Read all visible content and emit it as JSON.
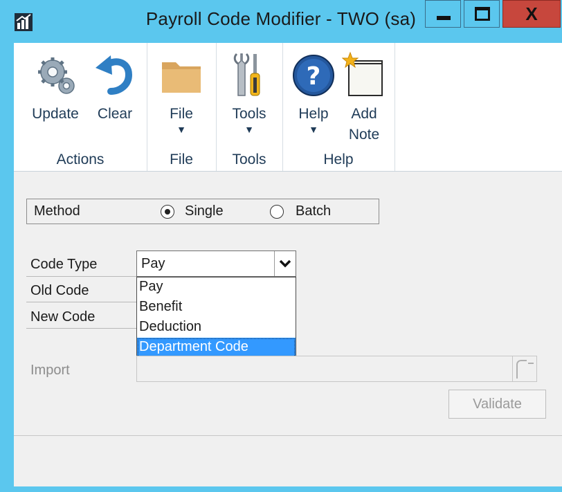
{
  "window": {
    "title": "Payroll Code Modifier  -  TWO (sa)",
    "close_glyph": "X",
    "icons": {
      "app": "chart-icon",
      "minimize": "minimize-icon",
      "maximize": "maximize-icon",
      "close": "close-icon"
    },
    "colors": {
      "frame": "#5bc7ee",
      "close": "#c7473d"
    }
  },
  "ribbon": {
    "groups": [
      {
        "label": "Actions",
        "buttons": [
          {
            "label": "Update",
            "icon": "gears-icon"
          },
          {
            "label": "Clear",
            "icon": "undo-arrow-icon"
          }
        ]
      },
      {
        "label": "File",
        "buttons": [
          {
            "label": "File",
            "icon": "folder-icon",
            "dropdown_glyph": "▼"
          }
        ]
      },
      {
        "label": "Tools",
        "buttons": [
          {
            "label": "Tools",
            "icon": "tools-icon",
            "dropdown_glyph": "▼"
          }
        ]
      },
      {
        "label": "Help",
        "buttons": [
          {
            "label": "Help",
            "icon": "help-icon",
            "dropdown_glyph": "▼"
          },
          {
            "label": "Add",
            "label2": "Note",
            "icon": "add-note-icon"
          }
        ]
      }
    ]
  },
  "form": {
    "method": {
      "label": "Method",
      "options": [
        {
          "label": "Single",
          "checked": true
        },
        {
          "label": "Batch",
          "checked": false
        }
      ]
    },
    "code_type": {
      "label": "Code Type",
      "value": "Pay",
      "options": [
        "Pay",
        "Benefit",
        "Deduction",
        "Department Code"
      ],
      "highlighted": "Department Code"
    },
    "old_code": {
      "label": "Old Code"
    },
    "new_code": {
      "label": "New Code"
    },
    "import": {
      "label": "Import"
    },
    "validate_label": "Validate"
  }
}
